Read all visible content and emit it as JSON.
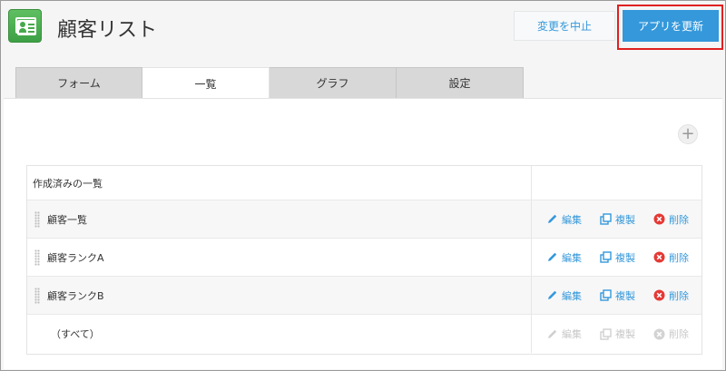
{
  "app": {
    "title": "顧客リスト",
    "icon": "customer-card-icon",
    "accent_color": "#3498db",
    "icon_color": "#4caf50"
  },
  "header": {
    "cancel_label": "変更を中止",
    "update_label": "アプリを更新",
    "highlight_color": "#e02020"
  },
  "tabs": [
    {
      "label": "フォーム",
      "active": false
    },
    {
      "label": "一覧",
      "active": true
    },
    {
      "label": "グラフ",
      "active": false
    },
    {
      "label": "設定",
      "active": false
    }
  ],
  "list": {
    "header": "作成済みの一覧",
    "rows": [
      {
        "name": "顧客一覧",
        "enabled": true
      },
      {
        "name": "顧客ランクA",
        "enabled": true
      },
      {
        "name": "顧客ランクB",
        "enabled": true
      },
      {
        "name": "（すべて）",
        "enabled": false
      }
    ],
    "actions": {
      "edit": "編集",
      "copy": "複製",
      "delete": "削除"
    }
  },
  "add_button_icon": "plus-icon",
  "delete_icon_color": "#e53935"
}
